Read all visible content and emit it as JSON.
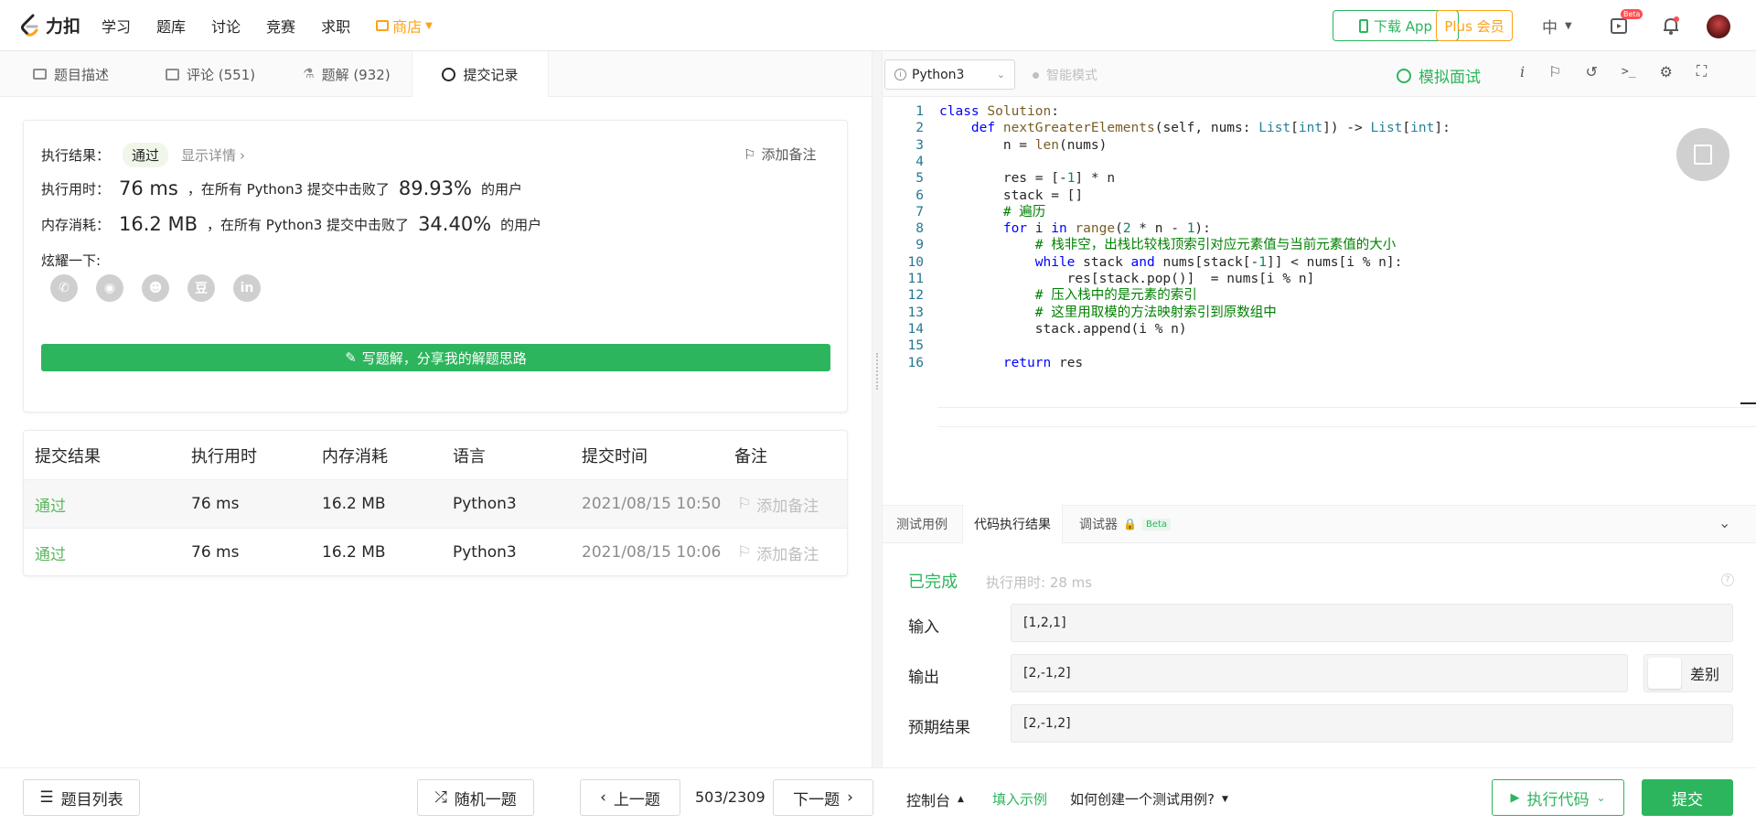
{
  "topnav": {
    "logo_text": "力扣",
    "links": [
      "学习",
      "题库",
      "讨论",
      "竞赛",
      "求职"
    ],
    "shop": "商店",
    "download_app": "下载 App",
    "plus": "Plus 会员",
    "lang": "中",
    "beta_badge": "Beta"
  },
  "left_tabs": [
    {
      "label": "题目描述",
      "icon": "description-icon"
    },
    {
      "label": "评论 (551)",
      "icon": "comment-icon"
    },
    {
      "label": "题解 (932)",
      "icon": "flask-icon"
    },
    {
      "label": "提交记录",
      "icon": "clock-icon"
    }
  ],
  "result": {
    "label": "执行结果：",
    "status": "通过",
    "details": "显示详情",
    "add_note": "添加备注",
    "time_label": "执行用时：",
    "time_value": "76 ms",
    "time_mid": "，在所有 Python3 提交中击败了",
    "time_pct": "89.93%",
    "time_tail": "的用户",
    "mem_label": "内存消耗：",
    "mem_value": "16.2 MB",
    "mem_mid": "，在所有 Python3 提交中击败了",
    "mem_pct": "34.40%",
    "mem_tail": "的用户",
    "share_label": "炫耀一下:",
    "share_icons": [
      "wechat-icon",
      "weibo-icon",
      "qq-icon",
      "douban-icon",
      "linkedin-icon"
    ],
    "share_glyphs": [
      "✆",
      "◉",
      "☻",
      "豆",
      "in"
    ],
    "write_solution": "写题解，分享我的解题思路"
  },
  "submissions": {
    "headers": [
      "提交结果",
      "执行用时",
      "内存消耗",
      "语言",
      "提交时间",
      "备注"
    ],
    "rows": [
      {
        "result": "通过",
        "time": "76 ms",
        "memory": "16.2 MB",
        "lang": "Python3",
        "date": "2021/08/15 10:50",
        "note": "添加备注"
      },
      {
        "result": "通过",
        "time": "76 ms",
        "memory": "16.2 MB",
        "lang": "Python3",
        "date": "2021/08/15 10:06",
        "note": "添加备注"
      }
    ]
  },
  "editor_toolbar": {
    "language": "Python3",
    "smart_mode": "智能模式",
    "mock_interview": "模拟面试"
  },
  "code_lines": [
    "class Solution:",
    "    def nextGreaterElements(self, nums: List[int]) -> List[int]:",
    "        n = len(nums)",
    "",
    "        res = [-1] * n",
    "        stack = []",
    "        # 遍历",
    "        for i in range(2 * n - 1):",
    "            # 栈非空，出栈比较栈顶索引对应元素值与当前元素值的大小",
    "            while stack and nums[stack[-1]] < nums[i % n]:",
    "                res[stack.pop()]  = nums[i % n]",
    "            # 压入栈中的是元素的索引",
    "            # 这里用取模的方法映射索引到原数组中",
    "            stack.append(i % n)",
    "",
    "        return res"
  ],
  "console": {
    "tabs": [
      "测试用例",
      "代码执行结果",
      "调试器"
    ],
    "beta": "Beta",
    "status": "已完成",
    "exec_time": "执行用时: 28 ms",
    "input_label": "输入",
    "input_value": "[1,2,1]",
    "output_label": "输出",
    "output_value": "[2,-1,2]",
    "diff_label": "差别",
    "expected_label": "预期结果",
    "expected_value": "[2,-1,2]"
  },
  "bottom": {
    "problem_list": "题目列表",
    "random": "随机一题",
    "prev": "上一题",
    "counter": "503/2309",
    "next": "下一题",
    "console": "控制台",
    "fill_example": "填入示例",
    "how_create": "如何创建一个测试用例?",
    "run_code": "执行代码",
    "submit": "提交"
  },
  "colors": {
    "green": "#2db55d",
    "accent_orange": "#ffa116",
    "pass_green": "#5cb85c"
  }
}
